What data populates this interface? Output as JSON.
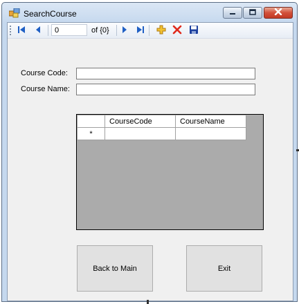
{
  "window": {
    "title": "SearchCourse",
    "icons": {
      "app": "form-app-icon",
      "minimize": "minimize-icon",
      "maximize": "maximize-icon",
      "close": "close-icon"
    }
  },
  "navigator": {
    "position_value": "0",
    "count_label": "of {0}",
    "icons": [
      "move-first-icon",
      "move-previous-icon",
      "move-next-icon",
      "move-last-icon",
      "add-new-icon",
      "delete-icon",
      "save-icon"
    ]
  },
  "form": {
    "course_code_label": "Course Code:",
    "course_code_value": "",
    "course_name_label": "Course Name:",
    "course_name_value": ""
  },
  "grid": {
    "columns": [
      "CourseCode",
      "CourseName"
    ],
    "new_row_marker": "*",
    "background_color": "#ababab"
  },
  "buttons": {
    "back_label": "Back to Main",
    "exit_label": "Exit"
  },
  "colors": {
    "client_bg": "#f0f0f0",
    "close_button": "#c23a25",
    "nav_blue": "#1f5fc4"
  }
}
